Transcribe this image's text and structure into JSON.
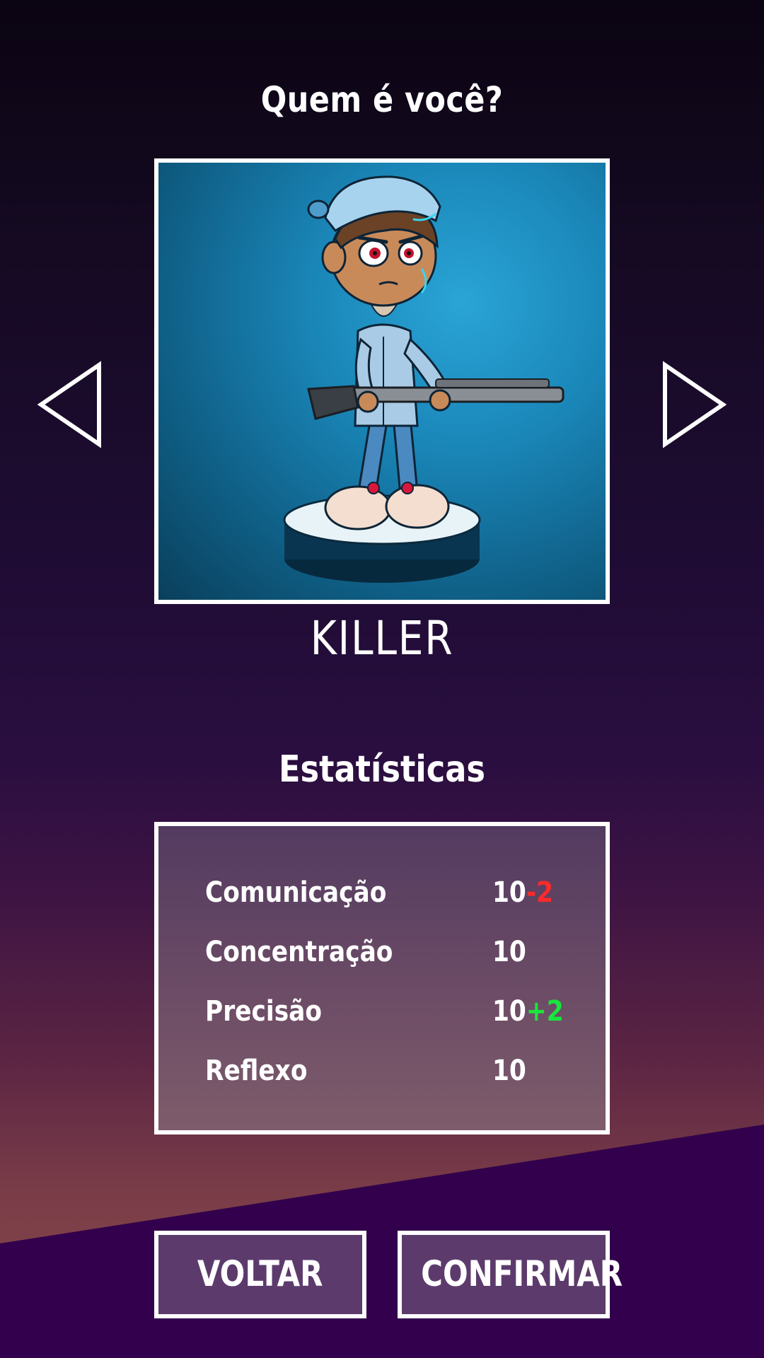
{
  "header": {
    "title": "Quem é você?"
  },
  "character": {
    "name": "KILLER",
    "portrait_description_icon": "character-portrait"
  },
  "navigation": {
    "prev_icon": "arrow-left-icon",
    "next_icon": "arrow-right-icon"
  },
  "stats": {
    "title": "Estatísticas",
    "rows": [
      {
        "label": "Comunicação",
        "value": "10",
        "modifier": "-2",
        "modifier_type": "negative"
      },
      {
        "label": "Concentração",
        "value": "10",
        "modifier": "",
        "modifier_type": "none"
      },
      {
        "label": "Precisão",
        "value": "10",
        "modifier": "+2",
        "modifier_type": "positive"
      },
      {
        "label": "Reflexo",
        "value": "10",
        "modifier": "",
        "modifier_type": "none"
      }
    ]
  },
  "buttons": {
    "back_label": "VOLTAR",
    "confirm_label": "CONFIRMAR"
  },
  "colors": {
    "negative": "#ff2a2a",
    "positive": "#19e63c",
    "button_bg": "#5c3b6c",
    "frame": "#ffffff"
  }
}
